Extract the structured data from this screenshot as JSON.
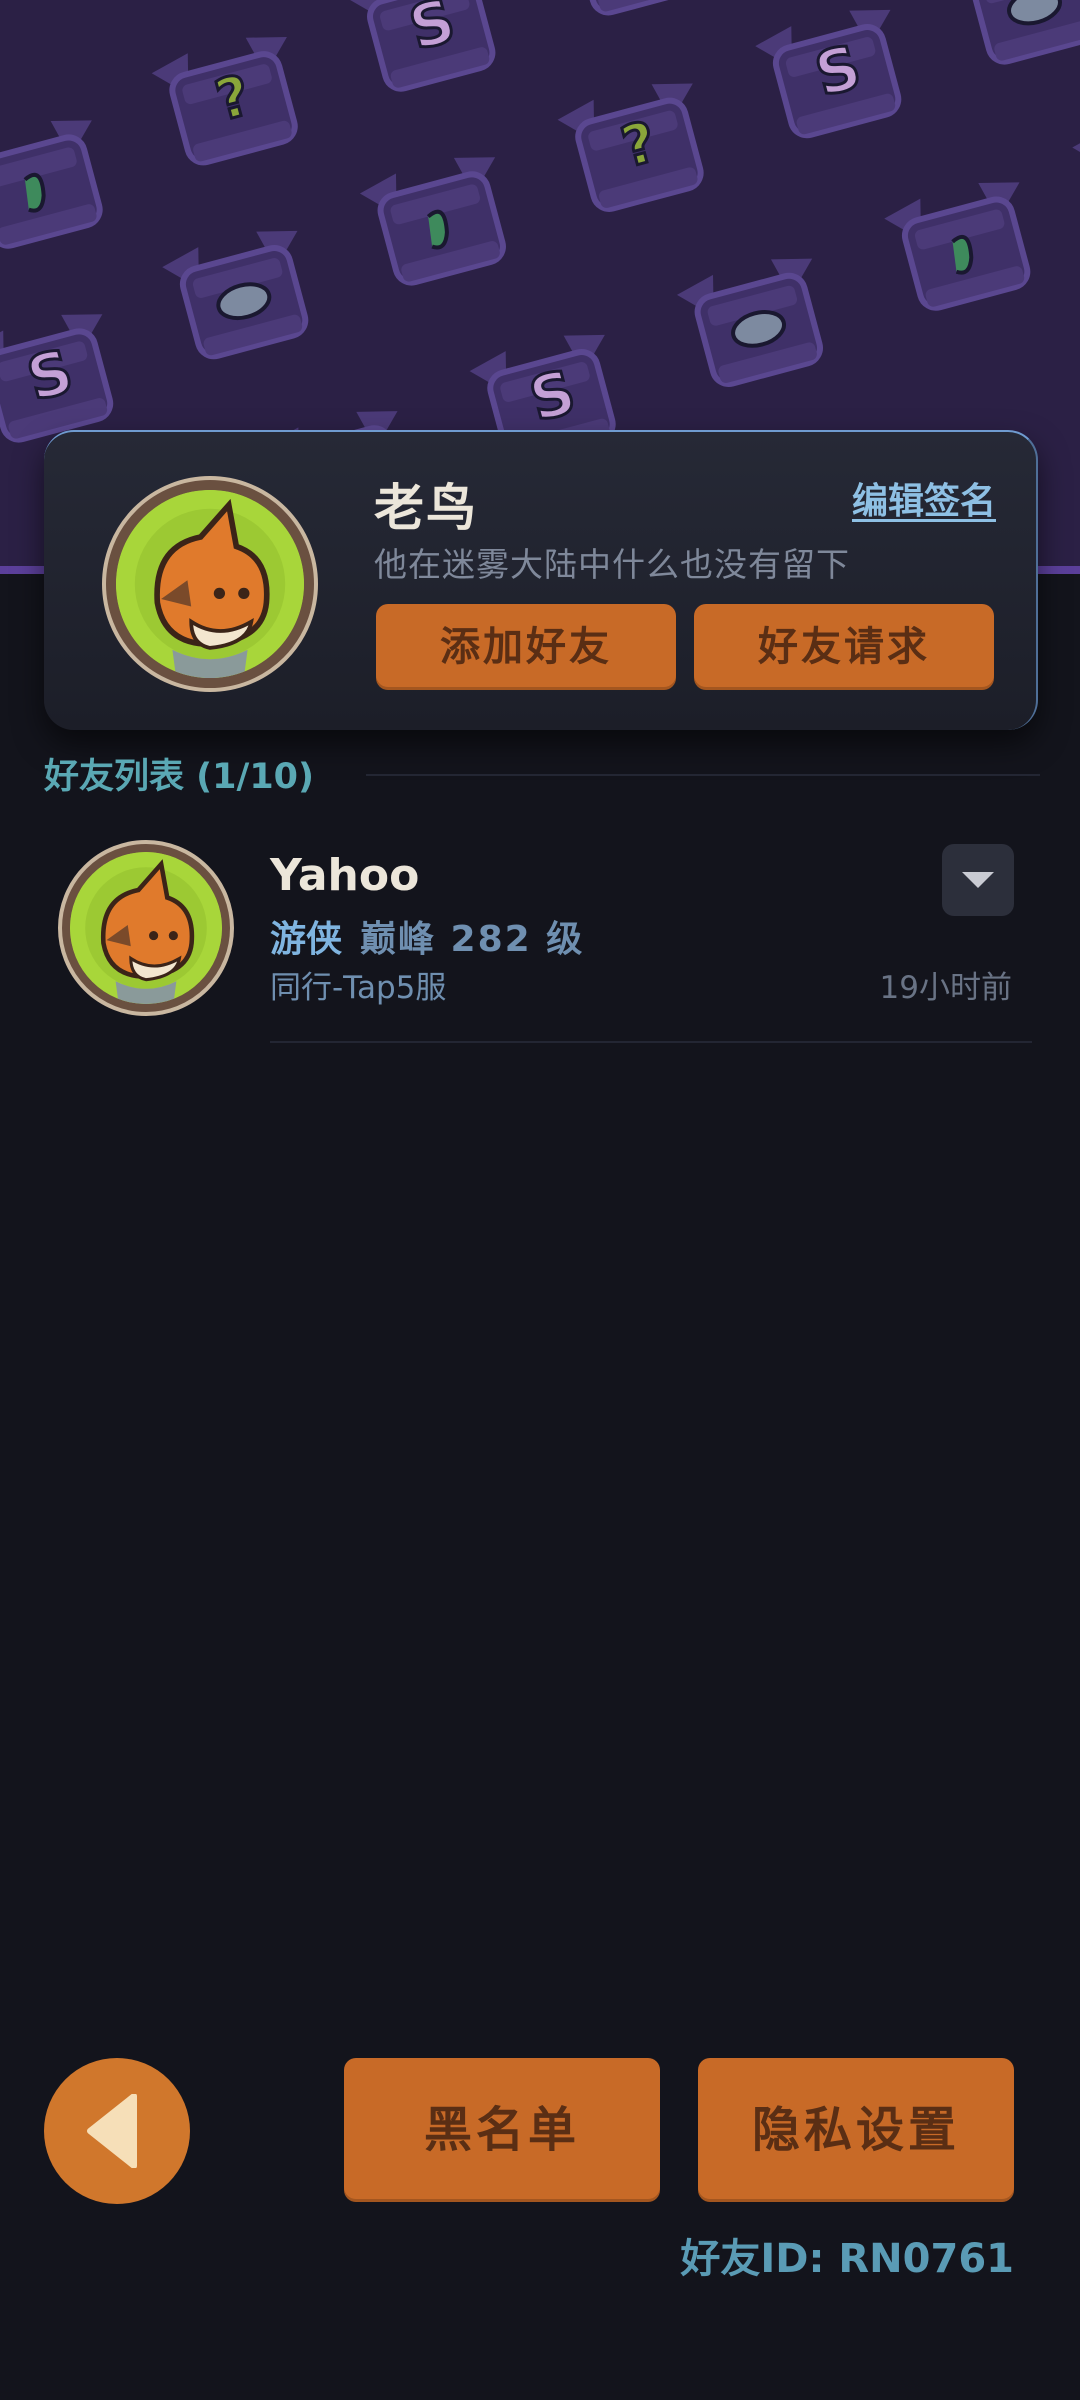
{
  "profile": {
    "name": "老鸟",
    "edit_signature_label": "编辑签名",
    "motto": "他在迷雾大陆中什么也没有留下",
    "add_friend_label": "添加好友",
    "friend_request_label": "好友请求"
  },
  "friend_list": {
    "title": "好友列表 (1/10)",
    "friends": [
      {
        "name": "Yahoo",
        "class": "游侠",
        "level": "巅峰 282 级",
        "server": "同行-Tap5服",
        "last_seen": "19小时前"
      }
    ]
  },
  "bottom_bar": {
    "blacklist_label": "黑名单",
    "privacy_label": "隐私设置",
    "friend_id": "好友ID: RN0761"
  },
  "colors": {
    "background": "#13141c",
    "accent_orange": "#c86a27",
    "banner": "#2b2045",
    "list_title": "#5aa8b4"
  },
  "icons": {
    "back": "back-arrow-icon",
    "dropdown": "chevron-down-icon",
    "avatar": "fox-avatar-icon"
  }
}
